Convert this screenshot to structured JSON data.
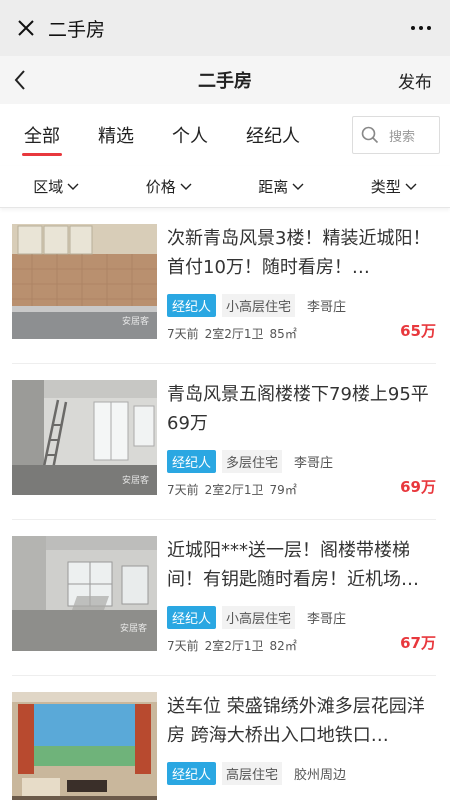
{
  "wechat": {
    "title": "二手房"
  },
  "header": {
    "title": "二手房",
    "publish_label": "发布"
  },
  "tabs": [
    {
      "label": "全部",
      "active": true
    },
    {
      "label": "精选",
      "active": false
    },
    {
      "label": "个人",
      "active": false
    },
    {
      "label": "经纪人",
      "active": false
    }
  ],
  "search": {
    "placeholder": "搜索"
  },
  "filters": [
    {
      "label": "区域"
    },
    {
      "label": "价格"
    },
    {
      "label": "距离"
    },
    {
      "label": "类型"
    }
  ],
  "listings": [
    {
      "title": "次新青岛风景3楼！精装近城阳！首付10万！随时看房！…",
      "agent_tag": "经纪人",
      "type": "小高层住宅",
      "area": "李哥庄",
      "posted": "7天前",
      "layout": "2室2厅1卫",
      "size": "85㎡",
      "price": "65万"
    },
    {
      "title": "青岛风景五阁楼楼下79楼上95平69万",
      "agent_tag": "经纪人",
      "type": "多层住宅",
      "area": "李哥庄",
      "posted": "7天前",
      "layout": "2室2厅1卫",
      "size": "79㎡",
      "price": "69万"
    },
    {
      "title": "近城阳***送一层！阁楼带楼梯间！有钥匙随时看房！近机场…",
      "agent_tag": "经纪人",
      "type": "小高层住宅",
      "area": "李哥庄",
      "posted": "7天前",
      "layout": "2室2厅1卫",
      "size": "82㎡",
      "price": "67万"
    },
    {
      "title": "送车位 荣盛锦绣外滩多层花园洋房 跨海大桥出入口地铁口…",
      "agent_tag": "经纪人",
      "type": "高层住宅",
      "area": "胶州周边",
      "posted": "",
      "layout": "",
      "size": "",
      "price": ""
    }
  ],
  "colors": {
    "accent_red": "#e8383d",
    "agent_blue": "#2aa7e2"
  }
}
